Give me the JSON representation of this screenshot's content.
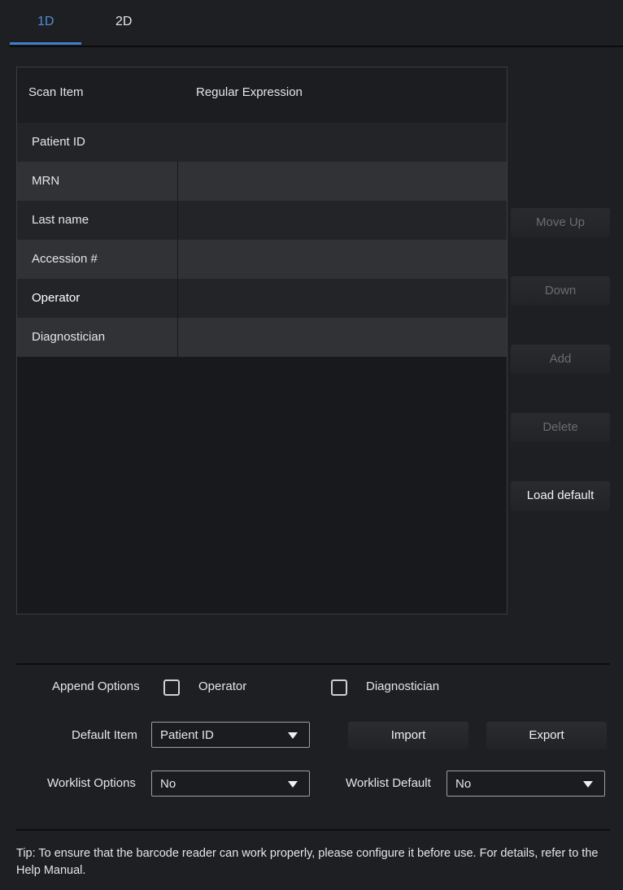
{
  "tabs": [
    {
      "label": "1D",
      "active": true
    },
    {
      "label": "2D",
      "active": false
    }
  ],
  "table": {
    "columns": [
      "Scan Item",
      "Regular Expression"
    ],
    "rows": [
      {
        "item": "Patient ID",
        "expression": ""
      },
      {
        "item": "MRN",
        "expression": ""
      },
      {
        "item": "Last name",
        "expression": ""
      },
      {
        "item": "Accession #",
        "expression": ""
      },
      {
        "item": "Operator",
        "expression": ""
      },
      {
        "item": "Diagnostician",
        "expression": ""
      }
    ]
  },
  "side_buttons": {
    "move_up": "Move Up",
    "down": "Down",
    "add": "Add",
    "delete": "Delete",
    "load_default": "Load default"
  },
  "append_options": {
    "label": "Append Options",
    "operator_label": "Operator",
    "operator_checked": false,
    "diagnostician_label": "Diagnostician",
    "diagnostician_checked": false
  },
  "default_item": {
    "label": "Default Item",
    "value": "Patient ID"
  },
  "import_label": "Import",
  "export_label": "Export",
  "worklist_options": {
    "label": "Worklist Options",
    "value": "No"
  },
  "worklist_default": {
    "label": "Worklist Default",
    "value": "No"
  },
  "tip": "Tip: To ensure that the barcode reader can work properly, please configure it before use. For details, refer to the Help Manual.",
  "colors": {
    "accent": "#3f7fd0",
    "background": "#1e1f23",
    "disabled_text": "#6b6c70"
  }
}
